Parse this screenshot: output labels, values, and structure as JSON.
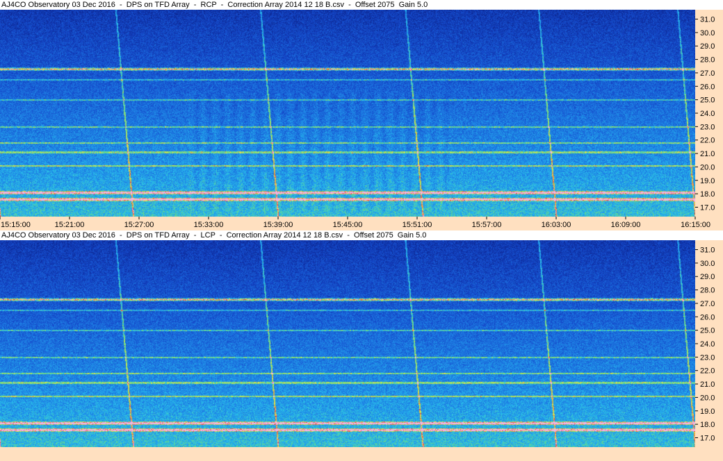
{
  "panels": [
    {
      "title": "AJ4CO Observatory 03 Dec 2016  -  DPS on TFD Array  -  RCP  -  Correction Array 2014 12 18 B.csv  -  Offset 2075  Gain 5.0"
    },
    {
      "title": "AJ4CO Observatory 03 Dec 2016  -  DPS on TFD Array  -  LCP  -  Correction Array 2014 12 18 B.csv  -  Offset 2075  Gain 5.0"
    }
  ],
  "colors": {
    "axis_bg": "#ffe0c0",
    "deep_blue": "#0a2a8c",
    "mid_blue": "#1b5fd6",
    "cyan": "#29b6e8",
    "green": "#7ee06a",
    "yellow": "#f2e64a",
    "red": "#e8323c"
  },
  "chart_data": [
    {
      "type": "heatmap",
      "title": "AJ4CO Observatory 03 Dec 2016  -  DPS on TFD Array  -  RCP  -  Correction Array 2014 12 18 B.csv  -  Offset 2075  Gain 5.0",
      "polarization": "RCP",
      "y_ticks": [
        "31.0",
        "30.0",
        "29.0",
        "28.0",
        "27.0",
        "26.0",
        "25.0",
        "24.0",
        "23.0",
        "22.0",
        "21.0",
        "20.0",
        "19.0",
        "18.0",
        "17.0"
      ],
      "y_tick_values": [
        31,
        30,
        29,
        28,
        27,
        26,
        25,
        24,
        23,
        22,
        21,
        20,
        19,
        18,
        17
      ],
      "ylim": [
        16.3,
        31.7
      ],
      "x_ticks": [
        "15:15:00",
        "15:21:00",
        "15:27:00",
        "15:33:00",
        "15:39:00",
        "15:45:00",
        "15:51:00",
        "15:57:00",
        "16:03:00",
        "16:09:00",
        "16:15:00"
      ],
      "xlim": [
        "15:15:00",
        "16:15:00"
      ],
      "features": {
        "strong_bands_mhz": [
          27.3,
          18.1,
          17.6
        ],
        "medium_bands_mhz": [
          21.8,
          21.1,
          20.1,
          23.0,
          25.0,
          26.5
        ],
        "sweep_start_times": [
          "15:15:00",
          "15:26:30",
          "15:39:00",
          "15:51:30",
          "16:03:00",
          "16:15:00"
        ]
      }
    },
    {
      "type": "heatmap",
      "title": "AJ4CO Observatory 03 Dec 2016  -  DPS on TFD Array  -  LCP  -  Correction Array 2014 12 18 B.csv  -  Offset 2075  Gain 5.0",
      "polarization": "LCP",
      "y_ticks": [
        "31.0",
        "30.0",
        "29.0",
        "28.0",
        "27.0",
        "26.0",
        "25.0",
        "24.0",
        "23.0",
        "22.0",
        "21.0",
        "20.0",
        "19.0",
        "18.0",
        "17.0"
      ],
      "y_tick_values": [
        31,
        30,
        29,
        28,
        27,
        26,
        25,
        24,
        23,
        22,
        21,
        20,
        19,
        18,
        17
      ],
      "ylim": [
        16.3,
        31.7
      ],
      "x_ticks": [],
      "xlim": [
        "15:15:00",
        "16:15:00"
      ],
      "features": {
        "strong_bands_mhz": [
          27.3,
          18.1,
          17.6
        ],
        "medium_bands_mhz": [
          21.8,
          21.1,
          20.1,
          23.0,
          25.0,
          26.5
        ],
        "sweep_start_times": [
          "15:15:00",
          "15:26:30",
          "15:39:00",
          "15:51:30",
          "16:03:00",
          "16:15:00"
        ]
      }
    }
  ]
}
